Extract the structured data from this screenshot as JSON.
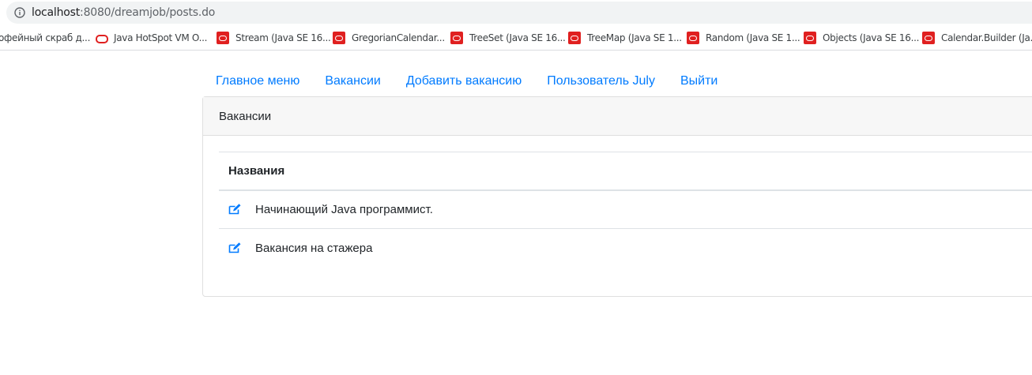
{
  "browser": {
    "url_host": "localhost",
    "url_path": ":8080/dreamjob/posts.do",
    "bookmarks": [
      {
        "label": "офейный скраб д...",
        "icon": "none"
      },
      {
        "label": "Java HotSpot VM O...",
        "icon": "oracle-ring-icon"
      },
      {
        "label": "Stream (Java SE 16...",
        "icon": "oracle-icon"
      },
      {
        "label": "GregorianCalendar...",
        "icon": "oracle-icon"
      },
      {
        "label": "TreeSet (Java SE 16...",
        "icon": "oracle-icon"
      },
      {
        "label": "TreeMap (Java SE 1...",
        "icon": "oracle-icon"
      },
      {
        "label": "Random (Java SE 1...",
        "icon": "oracle-icon"
      },
      {
        "label": "Objects (Java SE 16...",
        "icon": "oracle-icon"
      },
      {
        "label": "Calendar.Builder (Ja...",
        "icon": "oracle-icon"
      }
    ]
  },
  "nav": {
    "items": [
      "Главное меню",
      "Вакансии",
      "Добавить вакансию",
      "Пользователь July",
      "Выйти"
    ]
  },
  "card": {
    "header": "Вакансии",
    "table": {
      "column_header": "Названия",
      "rows": [
        "Начинающий Java программист.",
        "Вакансия на стажера"
      ]
    }
  },
  "colors": {
    "link": "#007bff",
    "oracle_red": "#e02020",
    "header_bg": "#f7f7f7"
  }
}
